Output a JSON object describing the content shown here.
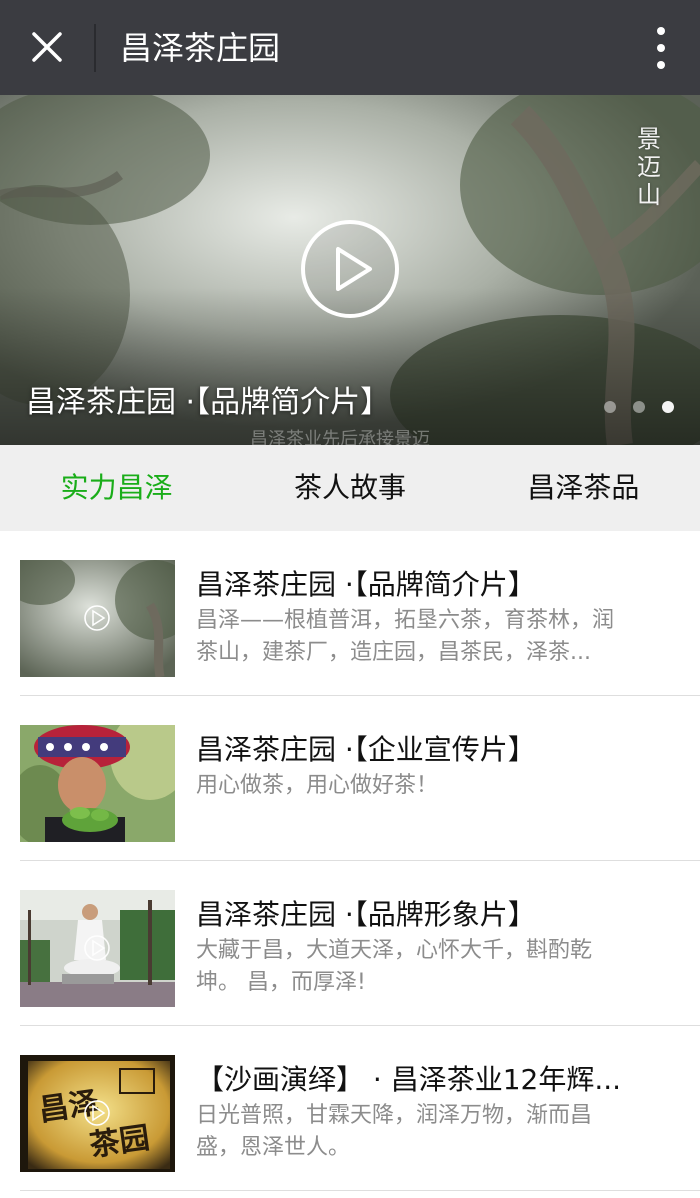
{
  "header": {
    "close_icon": "close-icon",
    "title": "昌泽茶庄园",
    "more_icon": "more-vertical-icon"
  },
  "banner": {
    "overlay_text": "景迈山",
    "caption": "昌泽茶庄园 ·【品牌简介片】",
    "subtitle": "昌泽茶业先后承接景迈",
    "play_icon": "play-circle-icon",
    "dots_count": 3,
    "active_dot": 3
  },
  "tabs": [
    {
      "label": "实力昌泽",
      "active": true
    },
    {
      "label": "茶人故事",
      "active": false
    },
    {
      "label": "昌泽茶品",
      "active": false
    }
  ],
  "colors": {
    "topbar": "#3b3c41",
    "active_tab": "#1aad19",
    "tabbar_bg": "#efefef",
    "desc_text": "#8c8c8c"
  },
  "videos": [
    {
      "title": "昌泽茶庄园 ·【品牌简介片】",
      "desc_line1": "昌泽——根植普洱，拓垦六茶，育茶林，润",
      "desc_line2": "茶山，建茶厂，造庄园，昌茶民，泽茶...",
      "thumb": "misty-tea-forest"
    },
    {
      "title": "昌泽茶庄园 ·【企业宣传片】",
      "desc_line1": "用心做茶，用心做好茶！",
      "desc_line2": "",
      "thumb": "girl-holding-tea-leaves"
    },
    {
      "title": "昌泽茶庄园 ·【品牌形象片】",
      "desc_line1": "大藏于昌，大道天泽，心怀大千，斟酌乾",
      "desc_line2": "坤。 昌，而厚泽!",
      "thumb": "man-meditating-garden"
    },
    {
      "title": "【沙画演绎】 · 昌泽茶业12年辉...",
      "desc_line1": "日光普照，甘霖天降，润泽万物，渐而昌",
      "desc_line2": "盛，恩泽世人。",
      "thumb": "sand-art-logo"
    }
  ]
}
